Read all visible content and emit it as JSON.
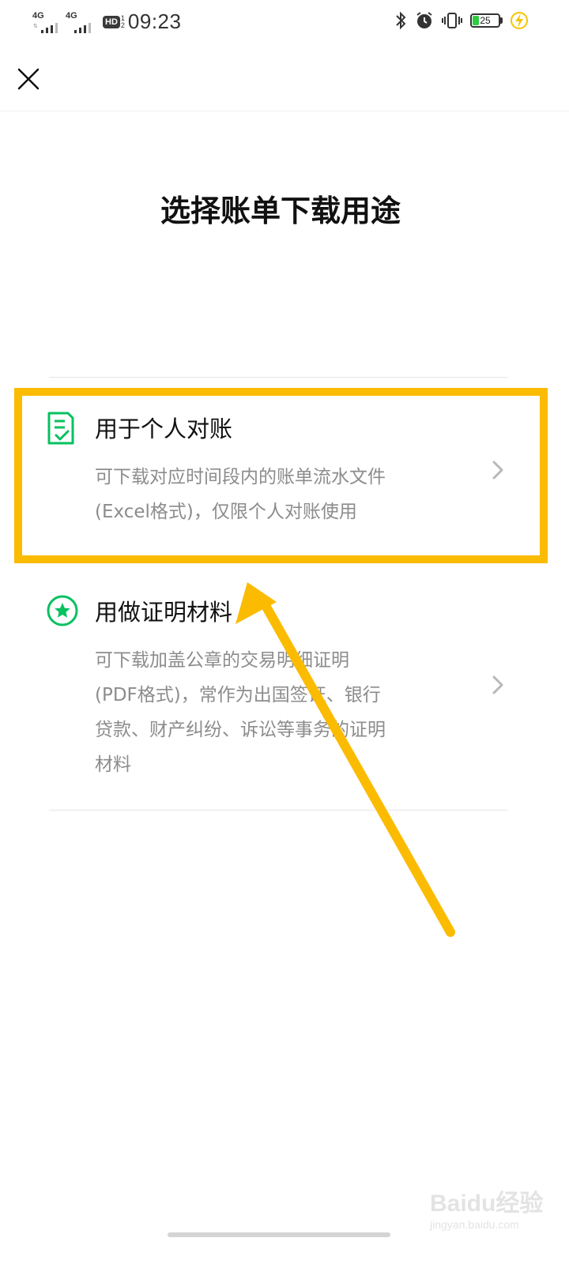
{
  "status_bar": {
    "sim1": "4G",
    "sim2": "4G",
    "hd_badge": "HD",
    "hd_top": "1",
    "hd_bottom": "2",
    "time": "09:23",
    "battery_level": "25",
    "battery_fraction": 0.25,
    "icons": [
      "bluetooth-icon",
      "alarm-icon",
      "vibrate-icon",
      "battery-icon",
      "charging-icon"
    ]
  },
  "nav": {
    "close_icon": "close-icon"
  },
  "page": {
    "title": "选择账单下载用途"
  },
  "options": [
    {
      "title": "用于个人对账",
      "desc_lines": [
        "可下载对应时间段内的账单流水文件",
        "(Excel格式)，仅限个人对账使用"
      ],
      "icon": "document-check-icon"
    },
    {
      "title": "用做证明材料",
      "desc_lines": [
        "可下载加盖公章的交易明细证明",
        "(PDF格式)，常作为出国签证、银行",
        "贷款、财产纠纷、诉讼等事务的证明",
        "材料"
      ],
      "icon": "star-badge-icon"
    }
  ],
  "colors": {
    "accent_green": "#07c160",
    "highlight_yellow": "#fbbb00",
    "desc_gray": "#8c8c8c"
  },
  "watermark": {
    "brand": "Baidu经验",
    "site": "jingyan.baidu.com"
  }
}
